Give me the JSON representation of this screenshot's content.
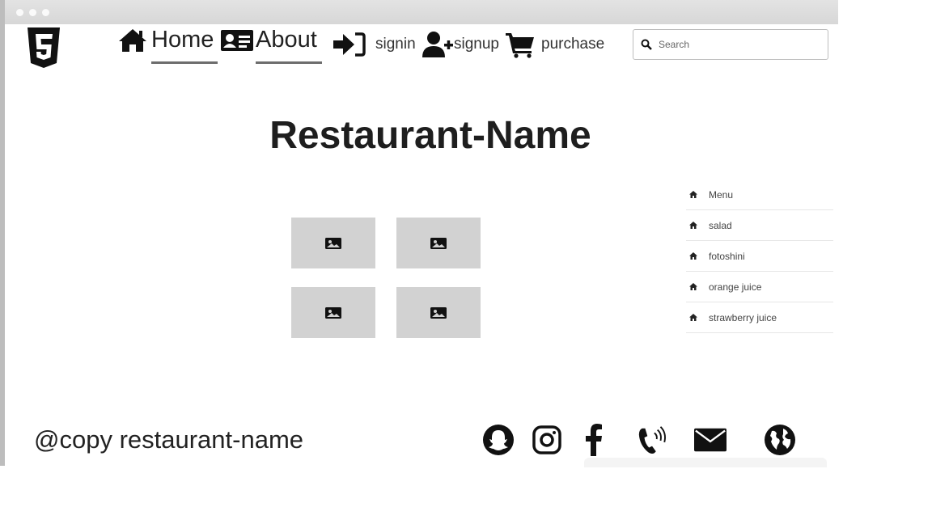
{
  "nav": {
    "home_label": "Home",
    "about_label": "About",
    "signin_label": "signin",
    "signup_label": "signup",
    "purchase_label": "purchase"
  },
  "search": {
    "placeholder": "Search"
  },
  "main": {
    "title": "Restaurant-Name"
  },
  "menu": {
    "items": [
      {
        "label": "Menu",
        "icon": "home-icon"
      },
      {
        "label": "salad",
        "icon": "home-icon"
      },
      {
        "label": "fotoshini",
        "icon": "home-icon"
      },
      {
        "label": "orange juice",
        "icon": "home-icon"
      },
      {
        "label": "strawberry juice",
        "icon": "home-icon"
      }
    ]
  },
  "footer": {
    "copy": "@copy restaurant-name",
    "social_icons": [
      "snapchat-icon",
      "instagram-icon",
      "facebook-icon",
      "phone-icon",
      "mail-icon",
      "globe-icon"
    ]
  },
  "colors": {
    "tile_bg": "#d2d2d2",
    "underline": "#6d6d6d",
    "text": "#1c1c1c"
  }
}
